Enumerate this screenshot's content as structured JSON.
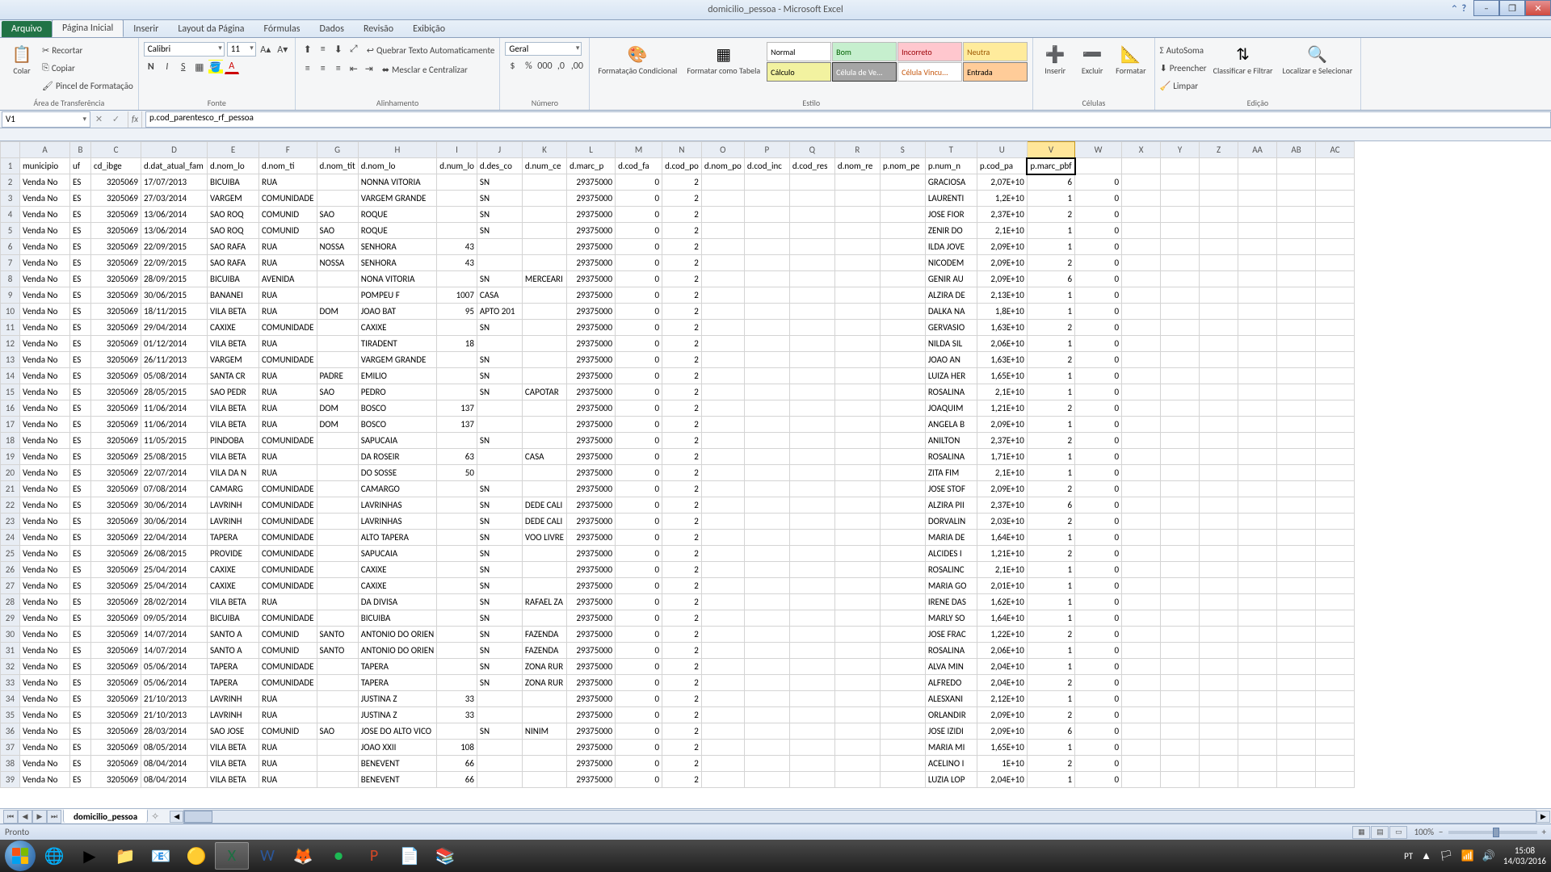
{
  "window": {
    "title": "domicilio_pessoa - Microsoft Excel",
    "minimize": "–",
    "maximize": "☐",
    "restore": "❐",
    "close": "✕"
  },
  "tabs": {
    "file": "Arquivo",
    "items": [
      "Página Inicial",
      "Inserir",
      "Layout da Página",
      "Fórmulas",
      "Dados",
      "Revisão",
      "Exibição"
    ],
    "active": 0
  },
  "ribbon": {
    "clipboard": {
      "label": "Área de Transferência",
      "paste": "Colar",
      "cut": "Recortar",
      "copy": "Copiar",
      "painter": "Pincel de Formatação"
    },
    "font": {
      "label": "Fonte",
      "name": "Calibri",
      "size": "11"
    },
    "align": {
      "label": "Alinhamento",
      "wrap": "Quebrar Texto Automaticamente",
      "merge": "Mesclar e Centralizar"
    },
    "number": {
      "label": "Número",
      "format": "Geral"
    },
    "cond": {
      "label": "Formatação Condicional",
      "table": "Formatar como Tabela",
      "styles_label": "Estilo",
      "cells": {
        "normal": "Normal",
        "bom": "Bom",
        "incorreto": "Incorreto",
        "neutra": "Neutra",
        "calculo": "Cálculo",
        "verif": "Célula de Ve...",
        "vincu": "Célula Vincu...",
        "entrada": "Entrada"
      }
    },
    "cells_grp": {
      "label": "Células",
      "insert": "Inserir",
      "delete": "Excluir",
      "format": "Formatar"
    },
    "editing": {
      "label": "Edição",
      "autosum": "AutoSoma",
      "fill": "Preencher",
      "clear": "Limpar",
      "sort": "Classificar e Filtrar",
      "find": "Localizar e Selecionar"
    }
  },
  "namebox": "V1",
  "formula": "p.cod_parentesco_rf_pessoa",
  "columns": [
    "A",
    "B",
    "C",
    "D",
    "E",
    "F",
    "G",
    "H",
    "I",
    "J",
    "K",
    "L",
    "M",
    "N",
    "O",
    "P",
    "Q",
    "R",
    "S",
    "T",
    "U",
    "V",
    "W",
    "X",
    "Y",
    "Z",
    "AA",
    "AB",
    "AC"
  ],
  "sel_col": "V",
  "headers": [
    "municipio",
    "uf",
    "cd_ibge",
    "d.dat_atual_fam",
    "d.nom_lo",
    "d.nom_ti",
    "d.nom_tit",
    "d.nom_lo",
    "d.num_lo",
    "d.des_co",
    "d.num_ce",
    "d.marc_p",
    "d.cod_fa",
    "d.cod_po",
    "d.nom_po",
    "d.cod_inc",
    "d.cod_res",
    "d.nom_re",
    "p.nom_pe",
    "p.num_n",
    "p.cod_pa",
    "p.marc_pbf"
  ],
  "rows": [
    {
      "n": 2,
      "A": "Venda No",
      "B": "ES",
      "C": "3205069",
      "D": "17/07/2013",
      "E": "BICUIBA",
      "F": "RUA",
      "G": "",
      "H": "NONNA VITORIA",
      "I": "",
      "J": "SN",
      "K": "",
      "L": "29375000",
      "M": "0",
      "N": "2",
      "T": "GRACIOSA",
      "U": "2,07E+10",
      "V": "6",
      "W": "0"
    },
    {
      "n": 3,
      "A": "Venda No",
      "B": "ES",
      "C": "3205069",
      "D": "27/03/2014",
      "E": "VARGEM",
      "F": "COMUNIDADE",
      "G": "",
      "H": "VARGEM GRANDE",
      "I": "",
      "J": "SN",
      "K": "",
      "L": "29375000",
      "M": "0",
      "N": "2",
      "T": "LAURENTI",
      "U": "1,2E+10",
      "V": "1",
      "W": "0"
    },
    {
      "n": 4,
      "A": "Venda No",
      "B": "ES",
      "C": "3205069",
      "D": "13/06/2014",
      "E": "SAO ROQ",
      "F": "COMUNID",
      "G": "SAO",
      "H": "ROQUE",
      "I": "",
      "J": "SN",
      "K": "",
      "L": "29375000",
      "M": "0",
      "N": "2",
      "T": "JOSE FIOR",
      "U": "2,37E+10",
      "V": "2",
      "W": "0"
    },
    {
      "n": 5,
      "A": "Venda No",
      "B": "ES",
      "C": "3205069",
      "D": "13/06/2014",
      "E": "SAO ROQ",
      "F": "COMUNID",
      "G": "SAO",
      "H": "ROQUE",
      "I": "",
      "J": "SN",
      "K": "",
      "L": "29375000",
      "M": "0",
      "N": "2",
      "T": "ZENIR DO",
      "U": "2,1E+10",
      "V": "1",
      "W": "0"
    },
    {
      "n": 6,
      "A": "Venda No",
      "B": "ES",
      "C": "3205069",
      "D": "22/09/2015",
      "E": "SAO RAFA",
      "F": "RUA",
      "G": "NOSSA",
      "H": "SENHORA",
      "I": "43",
      "J": "",
      "K": "",
      "L": "29375000",
      "M": "0",
      "N": "2",
      "T": "ILDA JOVE",
      "U": "2,09E+10",
      "V": "1",
      "W": "0"
    },
    {
      "n": 7,
      "A": "Venda No",
      "B": "ES",
      "C": "3205069",
      "D": "22/09/2015",
      "E": "SAO RAFA",
      "F": "RUA",
      "G": "NOSSA",
      "H": "SENHORA",
      "I": "43",
      "J": "",
      "K": "",
      "L": "29375000",
      "M": "0",
      "N": "2",
      "T": "NICODEM",
      "U": "2,09E+10",
      "V": "2",
      "W": "0"
    },
    {
      "n": 8,
      "A": "Venda No",
      "B": "ES",
      "C": "3205069",
      "D": "28/09/2015",
      "E": "BICUIBA",
      "F": "AVENIDA",
      "G": "",
      "H": "NONA VITORIA",
      "I": "",
      "J": "SN",
      "K": "MERCEARI",
      "L": "29375000",
      "M": "0",
      "N": "2",
      "T": "GENIR AU",
      "U": "2,09E+10",
      "V": "6",
      "W": "0"
    },
    {
      "n": 9,
      "A": "Venda No",
      "B": "ES",
      "C": "3205069",
      "D": "30/06/2015",
      "E": "BANANEI",
      "F": "RUA",
      "G": "",
      "H": "POMPEU F",
      "I": "1007",
      "J": "CASA",
      "K": "",
      "L": "29375000",
      "M": "0",
      "N": "2",
      "T": "ALZIRA DE",
      "U": "2,13E+10",
      "V": "1",
      "W": "0"
    },
    {
      "n": 10,
      "A": "Venda No",
      "B": "ES",
      "C": "3205069",
      "D": "18/11/2015",
      "E": "VILA BETA",
      "F": "RUA",
      "G": "DOM",
      "H": "JOAO BAT",
      "I": "95",
      "J": "APTO 201",
      "K": "",
      "L": "29375000",
      "M": "0",
      "N": "2",
      "T": "DALKA NA",
      "U": "1,8E+10",
      "V": "1",
      "W": "0"
    },
    {
      "n": 11,
      "A": "Venda No",
      "B": "ES",
      "C": "3205069",
      "D": "29/04/2014",
      "E": "CAXIXE",
      "F": "COMUNIDADE",
      "G": "",
      "H": "CAXIXE",
      "I": "",
      "J": "SN",
      "K": "",
      "L": "29375000",
      "M": "0",
      "N": "2",
      "T": "GERVASIO",
      "U": "1,63E+10",
      "V": "2",
      "W": "0"
    },
    {
      "n": 12,
      "A": "Venda No",
      "B": "ES",
      "C": "3205069",
      "D": "01/12/2014",
      "E": "VILA BETA",
      "F": "RUA",
      "G": "",
      "H": "TIRADENT",
      "I": "18",
      "J": "",
      "K": "",
      "L": "29375000",
      "M": "0",
      "N": "2",
      "T": "NILDA SIL",
      "U": "2,06E+10",
      "V": "1",
      "W": "0"
    },
    {
      "n": 13,
      "A": "Venda No",
      "B": "ES",
      "C": "3205069",
      "D": "26/11/2013",
      "E": "VARGEM",
      "F": "COMUNIDADE",
      "G": "",
      "H": "VARGEM GRANDE",
      "I": "",
      "J": "SN",
      "K": "",
      "L": "29375000",
      "M": "0",
      "N": "2",
      "T": "JOAO AN",
      "U": "1,63E+10",
      "V": "2",
      "W": "0"
    },
    {
      "n": 14,
      "A": "Venda No",
      "B": "ES",
      "C": "3205069",
      "D": "05/08/2014",
      "E": "SANTA CR",
      "F": "RUA",
      "G": "PADRE",
      "H": "EMILIO",
      "I": "",
      "J": "SN",
      "K": "",
      "L": "29375000",
      "M": "0",
      "N": "2",
      "T": "LUIZA HER",
      "U": "1,65E+10",
      "V": "1",
      "W": "0"
    },
    {
      "n": 15,
      "A": "Venda No",
      "B": "ES",
      "C": "3205069",
      "D": "28/05/2015",
      "E": "SAO PEDR",
      "F": "RUA",
      "G": "SAO",
      "H": "PEDRO",
      "I": "",
      "J": "SN",
      "K": "CAPOTAR",
      "L": "29375000",
      "M": "0",
      "N": "2",
      "T": "ROSALINA",
      "U": "2,1E+10",
      "V": "1",
      "W": "0"
    },
    {
      "n": 16,
      "A": "Venda No",
      "B": "ES",
      "C": "3205069",
      "D": "11/06/2014",
      "E": "VILA BETA",
      "F": "RUA",
      "G": "DOM",
      "H": "BOSCO",
      "I": "137",
      "J": "",
      "K": "",
      "L": "29375000",
      "M": "0",
      "N": "2",
      "T": "JOAQUIM",
      "U": "1,21E+10",
      "V": "2",
      "W": "0"
    },
    {
      "n": 17,
      "A": "Venda No",
      "B": "ES",
      "C": "3205069",
      "D": "11/06/2014",
      "E": "VILA BETA",
      "F": "RUA",
      "G": "DOM",
      "H": "BOSCO",
      "I": "137",
      "J": "",
      "K": "",
      "L": "29375000",
      "M": "0",
      "N": "2",
      "T": "ANGELA B",
      "U": "2,09E+10",
      "V": "1",
      "W": "0"
    },
    {
      "n": 18,
      "A": "Venda No",
      "B": "ES",
      "C": "3205069",
      "D": "11/05/2015",
      "E": "PINDOBA",
      "F": "COMUNIDADE",
      "G": "",
      "H": "SAPUCAIA",
      "I": "",
      "J": "SN",
      "K": "",
      "L": "29375000",
      "M": "0",
      "N": "2",
      "T": "ANILTON",
      "U": "2,37E+10",
      "V": "2",
      "W": "0"
    },
    {
      "n": 19,
      "A": "Venda No",
      "B": "ES",
      "C": "3205069",
      "D": "25/08/2015",
      "E": "VILA BETA",
      "F": "RUA",
      "G": "",
      "H": "DA ROSEIR",
      "I": "63",
      "J": "",
      "K": "CASA",
      "L": "29375000",
      "M": "0",
      "N": "2",
      "T": "ROSALINA",
      "U": "1,71E+10",
      "V": "1",
      "W": "0"
    },
    {
      "n": 20,
      "A": "Venda No",
      "B": "ES",
      "C": "3205069",
      "D": "22/07/2014",
      "E": "VILA DA N",
      "F": "RUA",
      "G": "",
      "H": "DO SOSSE",
      "I": "50",
      "J": "",
      "K": "",
      "L": "29375000",
      "M": "0",
      "N": "2",
      "T": "ZITA FIM",
      "U": "2,1E+10",
      "V": "1",
      "W": "0"
    },
    {
      "n": 21,
      "A": "Venda No",
      "B": "ES",
      "C": "3205069",
      "D": "07/08/2014",
      "E": "CAMARG",
      "F": "COMUNIDADE",
      "G": "",
      "H": "CAMARGO",
      "I": "",
      "J": "SN",
      "K": "",
      "L": "29375000",
      "M": "0",
      "N": "2",
      "T": "JOSE STOF",
      "U": "2,09E+10",
      "V": "2",
      "W": "0"
    },
    {
      "n": 22,
      "A": "Venda No",
      "B": "ES",
      "C": "3205069",
      "D": "30/06/2014",
      "E": "LAVRINH",
      "F": "COMUNIDADE",
      "G": "",
      "H": "LAVRINHAS",
      "I": "",
      "J": "SN",
      "K": "DEDE CALI",
      "L": "29375000",
      "M": "0",
      "N": "2",
      "T": "ALZIRA PII",
      "U": "2,37E+10",
      "V": "6",
      "W": "0"
    },
    {
      "n": 23,
      "A": "Venda No",
      "B": "ES",
      "C": "3205069",
      "D": "30/06/2014",
      "E": "LAVRINH",
      "F": "COMUNIDADE",
      "G": "",
      "H": "LAVRINHAS",
      "I": "",
      "J": "SN",
      "K": "DEDE CALI",
      "L": "29375000",
      "M": "0",
      "N": "2",
      "T": "DORVALIN",
      "U": "2,03E+10",
      "V": "2",
      "W": "0"
    },
    {
      "n": 24,
      "A": "Venda No",
      "B": "ES",
      "C": "3205069",
      "D": "22/04/2014",
      "E": "TAPERA",
      "F": "COMUNIDADE",
      "G": "",
      "H": "ALTO TAPERA",
      "I": "",
      "J": "SN",
      "K": "VOO LIVRE",
      "L": "29375000",
      "M": "0",
      "N": "2",
      "T": "MARIA DE",
      "U": "1,64E+10",
      "V": "1",
      "W": "0"
    },
    {
      "n": 25,
      "A": "Venda No",
      "B": "ES",
      "C": "3205069",
      "D": "26/08/2015",
      "E": "PROVIDE",
      "F": "COMUNIDADE",
      "G": "",
      "H": "SAPUCAIA",
      "I": "",
      "J": "SN",
      "K": "",
      "L": "29375000",
      "M": "0",
      "N": "2",
      "T": "ALCIDES I",
      "U": "1,21E+10",
      "V": "2",
      "W": "0"
    },
    {
      "n": 26,
      "A": "Venda No",
      "B": "ES",
      "C": "3205069",
      "D": "25/04/2014",
      "E": "CAXIXE",
      "F": "COMUNIDADE",
      "G": "",
      "H": "CAXIXE",
      "I": "",
      "J": "SN",
      "K": "",
      "L": "29375000",
      "M": "0",
      "N": "2",
      "T": "ROSALINC",
      "U": "2,1E+10",
      "V": "1",
      "W": "0"
    },
    {
      "n": 27,
      "A": "Venda No",
      "B": "ES",
      "C": "3205069",
      "D": "25/04/2014",
      "E": "CAXIXE",
      "F": "COMUNIDADE",
      "G": "",
      "H": "CAXIXE",
      "I": "",
      "J": "SN",
      "K": "",
      "L": "29375000",
      "M": "0",
      "N": "2",
      "T": "MARIA GO",
      "U": "2,01E+10",
      "V": "1",
      "W": "0"
    },
    {
      "n": 28,
      "A": "Venda No",
      "B": "ES",
      "C": "3205069",
      "D": "28/02/2014",
      "E": "VILA BETA",
      "F": "RUA",
      "G": "",
      "H": "DA DIVISA",
      "I": "",
      "J": "SN",
      "K": "RAFAEL ZA",
      "L": "29375000",
      "M": "0",
      "N": "2",
      "T": "IRENE DAS",
      "U": "1,62E+10",
      "V": "1",
      "W": "0"
    },
    {
      "n": 29,
      "A": "Venda No",
      "B": "ES",
      "C": "3205069",
      "D": "09/05/2014",
      "E": "BICUIBA",
      "F": "COMUNIDADE",
      "G": "",
      "H": "BICUIBA",
      "I": "",
      "J": "SN",
      "K": "",
      "L": "29375000",
      "M": "0",
      "N": "2",
      "T": "MARLY SO",
      "U": "1,64E+10",
      "V": "1",
      "W": "0"
    },
    {
      "n": 30,
      "A": "Venda No",
      "B": "ES",
      "C": "3205069",
      "D": "14/07/2014",
      "E": "SANTO A",
      "F": "COMUNID",
      "G": "SANTO",
      "H": "ANTONIO DO ORIEN",
      "I": "",
      "J": "SN",
      "K": "FAZENDA",
      "L": "29375000",
      "M": "0",
      "N": "2",
      "T": "JOSE FRAC",
      "U": "1,22E+10",
      "V": "2",
      "W": "0"
    },
    {
      "n": 31,
      "A": "Venda No",
      "B": "ES",
      "C": "3205069",
      "D": "14/07/2014",
      "E": "SANTO A",
      "F": "COMUNID",
      "G": "SANTO",
      "H": "ANTONIO DO ORIEN",
      "I": "",
      "J": "SN",
      "K": "FAZENDA",
      "L": "29375000",
      "M": "0",
      "N": "2",
      "T": "ROSALINA",
      "U": "2,06E+10",
      "V": "1",
      "W": "0"
    },
    {
      "n": 32,
      "A": "Venda No",
      "B": "ES",
      "C": "3205069",
      "D": "05/06/2014",
      "E": "TAPERA",
      "F": "COMUNIDADE",
      "G": "",
      "H": "TAPERA",
      "I": "",
      "J": "SN",
      "K": "ZONA RUR",
      "L": "29375000",
      "M": "0",
      "N": "2",
      "T": "ALVA MIN",
      "U": "2,04E+10",
      "V": "1",
      "W": "0"
    },
    {
      "n": 33,
      "A": "Venda No",
      "B": "ES",
      "C": "3205069",
      "D": "05/06/2014",
      "E": "TAPERA",
      "F": "COMUNIDADE",
      "G": "",
      "H": "TAPERA",
      "I": "",
      "J": "SN",
      "K": "ZONA RUR",
      "L": "29375000",
      "M": "0",
      "N": "2",
      "T": "ALFREDO",
      "U": "2,04E+10",
      "V": "2",
      "W": "0"
    },
    {
      "n": 34,
      "A": "Venda No",
      "B": "ES",
      "C": "3205069",
      "D": "21/10/2013",
      "E": "LAVRINH",
      "F": "RUA",
      "G": "",
      "H": "JUSTINA Z",
      "I": "33",
      "J": "",
      "K": "",
      "L": "29375000",
      "M": "0",
      "N": "2",
      "T": "ALESXANI",
      "U": "2,12E+10",
      "V": "1",
      "W": "0"
    },
    {
      "n": 35,
      "A": "Venda No",
      "B": "ES",
      "C": "3205069",
      "D": "21/10/2013",
      "E": "LAVRINH",
      "F": "RUA",
      "G": "",
      "H": "JUSTINA Z",
      "I": "33",
      "J": "",
      "K": "",
      "L": "29375000",
      "M": "0",
      "N": "2",
      "T": "ORLANDIR",
      "U": "2,09E+10",
      "V": "2",
      "W": "0"
    },
    {
      "n": 36,
      "A": "Venda No",
      "B": "ES",
      "C": "3205069",
      "D": "28/03/2014",
      "E": "SAO JOSE",
      "F": "COMUNID",
      "G": "SAO",
      "H": "JOSE DO ALTO VICO",
      "I": "",
      "J": "SN",
      "K": "NINIM",
      "L": "29375000",
      "M": "0",
      "N": "2",
      "T": "JOSE IZIDI",
      "U": "2,09E+10",
      "V": "6",
      "W": "0"
    },
    {
      "n": 37,
      "A": "Venda No",
      "B": "ES",
      "C": "3205069",
      "D": "08/05/2014",
      "E": "VILA BETA",
      "F": "RUA",
      "G": "",
      "H": "JOAO XXII",
      "I": "108",
      "J": "",
      "K": "",
      "L": "29375000",
      "M": "0",
      "N": "2",
      "T": "MARIA MI",
      "U": "1,65E+10",
      "V": "1",
      "W": "0"
    },
    {
      "n": 38,
      "A": "Venda No",
      "B": "ES",
      "C": "3205069",
      "D": "08/04/2014",
      "E": "VILA BETA",
      "F": "RUA",
      "G": "",
      "H": "BENEVENT",
      "I": "66",
      "J": "",
      "K": "",
      "L": "29375000",
      "M": "0",
      "N": "2",
      "T": "ACELINO I",
      "U": "1E+10",
      "V": "2",
      "W": "0"
    },
    {
      "n": 39,
      "A": "Venda No",
      "B": "ES",
      "C": "3205069",
      "D": "08/04/2014",
      "E": "VILA BETA",
      "F": "RUA",
      "G": "",
      "H": "BENEVENT",
      "I": "66",
      "J": "",
      "K": "",
      "L": "29375000",
      "M": "0",
      "N": "2",
      "T": "LUZIA LOP",
      "U": "2,04E+10",
      "V": "1",
      "W": "0"
    }
  ],
  "sheet": {
    "name": "domicilio_pessoa"
  },
  "status": {
    "ready": "Pronto",
    "zoom": "100%",
    "lang": "PT"
  },
  "clock": {
    "time": "15:08",
    "date": "14/03/2016"
  }
}
